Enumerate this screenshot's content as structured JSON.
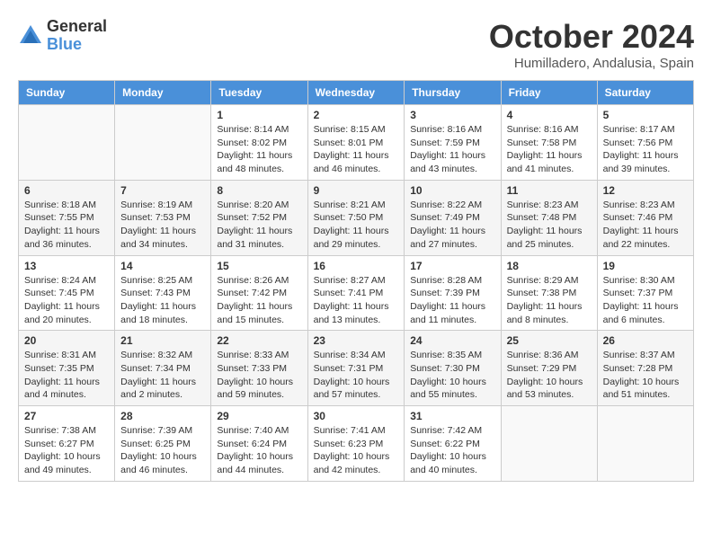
{
  "header": {
    "logo_general": "General",
    "logo_blue": "Blue",
    "month_title": "October 2024",
    "location": "Humilladero, Andalusia, Spain"
  },
  "weekdays": [
    "Sunday",
    "Monday",
    "Tuesday",
    "Wednesday",
    "Thursday",
    "Friday",
    "Saturday"
  ],
  "weeks": [
    [
      {
        "day": "",
        "info": ""
      },
      {
        "day": "",
        "info": ""
      },
      {
        "day": "1",
        "info": "Sunrise: 8:14 AM\nSunset: 8:02 PM\nDaylight: 11 hours and 48 minutes."
      },
      {
        "day": "2",
        "info": "Sunrise: 8:15 AM\nSunset: 8:01 PM\nDaylight: 11 hours and 46 minutes."
      },
      {
        "day": "3",
        "info": "Sunrise: 8:16 AM\nSunset: 7:59 PM\nDaylight: 11 hours and 43 minutes."
      },
      {
        "day": "4",
        "info": "Sunrise: 8:16 AM\nSunset: 7:58 PM\nDaylight: 11 hours and 41 minutes."
      },
      {
        "day": "5",
        "info": "Sunrise: 8:17 AM\nSunset: 7:56 PM\nDaylight: 11 hours and 39 minutes."
      }
    ],
    [
      {
        "day": "6",
        "info": "Sunrise: 8:18 AM\nSunset: 7:55 PM\nDaylight: 11 hours and 36 minutes."
      },
      {
        "day": "7",
        "info": "Sunrise: 8:19 AM\nSunset: 7:53 PM\nDaylight: 11 hours and 34 minutes."
      },
      {
        "day": "8",
        "info": "Sunrise: 8:20 AM\nSunset: 7:52 PM\nDaylight: 11 hours and 31 minutes."
      },
      {
        "day": "9",
        "info": "Sunrise: 8:21 AM\nSunset: 7:50 PM\nDaylight: 11 hours and 29 minutes."
      },
      {
        "day": "10",
        "info": "Sunrise: 8:22 AM\nSunset: 7:49 PM\nDaylight: 11 hours and 27 minutes."
      },
      {
        "day": "11",
        "info": "Sunrise: 8:23 AM\nSunset: 7:48 PM\nDaylight: 11 hours and 25 minutes."
      },
      {
        "day": "12",
        "info": "Sunrise: 8:23 AM\nSunset: 7:46 PM\nDaylight: 11 hours and 22 minutes."
      }
    ],
    [
      {
        "day": "13",
        "info": "Sunrise: 8:24 AM\nSunset: 7:45 PM\nDaylight: 11 hours and 20 minutes."
      },
      {
        "day": "14",
        "info": "Sunrise: 8:25 AM\nSunset: 7:43 PM\nDaylight: 11 hours and 18 minutes."
      },
      {
        "day": "15",
        "info": "Sunrise: 8:26 AM\nSunset: 7:42 PM\nDaylight: 11 hours and 15 minutes."
      },
      {
        "day": "16",
        "info": "Sunrise: 8:27 AM\nSunset: 7:41 PM\nDaylight: 11 hours and 13 minutes."
      },
      {
        "day": "17",
        "info": "Sunrise: 8:28 AM\nSunset: 7:39 PM\nDaylight: 11 hours and 11 minutes."
      },
      {
        "day": "18",
        "info": "Sunrise: 8:29 AM\nSunset: 7:38 PM\nDaylight: 11 hours and 8 minutes."
      },
      {
        "day": "19",
        "info": "Sunrise: 8:30 AM\nSunset: 7:37 PM\nDaylight: 11 hours and 6 minutes."
      }
    ],
    [
      {
        "day": "20",
        "info": "Sunrise: 8:31 AM\nSunset: 7:35 PM\nDaylight: 11 hours and 4 minutes."
      },
      {
        "day": "21",
        "info": "Sunrise: 8:32 AM\nSunset: 7:34 PM\nDaylight: 11 hours and 2 minutes."
      },
      {
        "day": "22",
        "info": "Sunrise: 8:33 AM\nSunset: 7:33 PM\nDaylight: 10 hours and 59 minutes."
      },
      {
        "day": "23",
        "info": "Sunrise: 8:34 AM\nSunset: 7:31 PM\nDaylight: 10 hours and 57 minutes."
      },
      {
        "day": "24",
        "info": "Sunrise: 8:35 AM\nSunset: 7:30 PM\nDaylight: 10 hours and 55 minutes."
      },
      {
        "day": "25",
        "info": "Sunrise: 8:36 AM\nSunset: 7:29 PM\nDaylight: 10 hours and 53 minutes."
      },
      {
        "day": "26",
        "info": "Sunrise: 8:37 AM\nSunset: 7:28 PM\nDaylight: 10 hours and 51 minutes."
      }
    ],
    [
      {
        "day": "27",
        "info": "Sunrise: 7:38 AM\nSunset: 6:27 PM\nDaylight: 10 hours and 49 minutes."
      },
      {
        "day": "28",
        "info": "Sunrise: 7:39 AM\nSunset: 6:25 PM\nDaylight: 10 hours and 46 minutes."
      },
      {
        "day": "29",
        "info": "Sunrise: 7:40 AM\nSunset: 6:24 PM\nDaylight: 10 hours and 44 minutes."
      },
      {
        "day": "30",
        "info": "Sunrise: 7:41 AM\nSunset: 6:23 PM\nDaylight: 10 hours and 42 minutes."
      },
      {
        "day": "31",
        "info": "Sunrise: 7:42 AM\nSunset: 6:22 PM\nDaylight: 10 hours and 40 minutes."
      },
      {
        "day": "",
        "info": ""
      },
      {
        "day": "",
        "info": ""
      }
    ]
  ]
}
